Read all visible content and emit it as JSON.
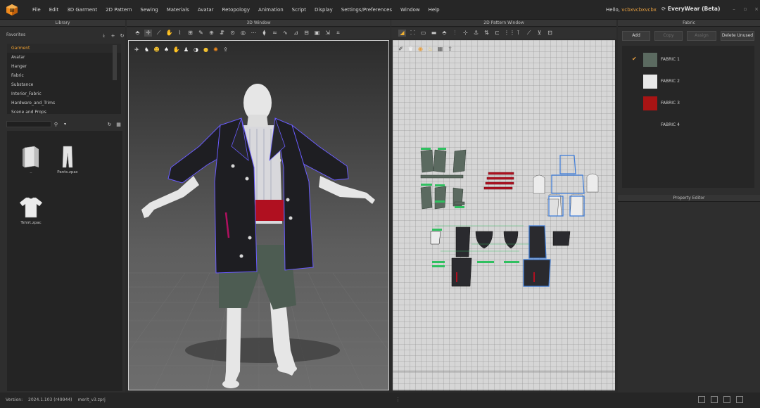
{
  "menubar": {
    "items": [
      "File",
      "Edit",
      "3D Garment",
      "2D Pattern",
      "Sewing",
      "Materials",
      "Avatar",
      "Retopology",
      "Animation",
      "Script",
      "Display",
      "Settings/Preferences",
      "Window",
      "Help"
    ],
    "hello_label": "Hello,",
    "username": "vcbxvcbxvcbx",
    "workspace": "EveryWear (Beta)"
  },
  "library": {
    "title": "Library",
    "favorites_label": "Favorites",
    "items": [
      "Garment",
      "Avatar",
      "Hanger",
      "Fabric",
      "Substance",
      "Interior_Fabric",
      "Hardware_and_Trims",
      "Scene and Props"
    ],
    "selected": "Garment",
    "files": [
      {
        "name": "..",
        "icon": "folder-icon"
      },
      {
        "name": "Pants.zpac",
        "icon": "pants-icon"
      },
      {
        "name": "Tshirt.zpac",
        "icon": "tshirt-icon"
      }
    ]
  },
  "viewport3d": {
    "title": "3D Window"
  },
  "pattern2d": {
    "title": "2D Pattern Window"
  },
  "fabric": {
    "title": "Fabric",
    "buttons": {
      "add": "Add",
      "copy": "Copy",
      "assign": "Assign",
      "delete_unused": "Delete Unused"
    },
    "items": [
      {
        "name": "FABRIC 1",
        "color": "#5b6a60",
        "checked": true
      },
      {
        "name": "FABRIC 2",
        "color": "#e8e8e8",
        "checked": false
      },
      {
        "name": "FABRIC 3",
        "color": "#a81414",
        "checked": false
      },
      {
        "name": "FABRIC 4",
        "color": "",
        "checked": false
      }
    ]
  },
  "property_editor": {
    "title": "Property Editor"
  },
  "status": {
    "version_label": "Version:",
    "version": "2024.1.103 (r49944)",
    "file": "merit_v3.zprj"
  }
}
